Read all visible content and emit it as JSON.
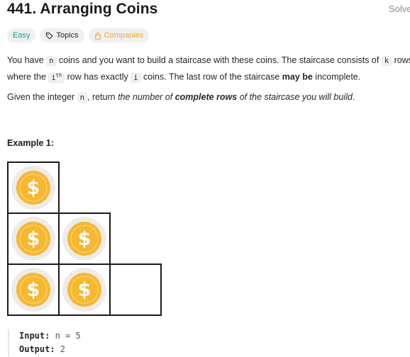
{
  "problem": {
    "title": "441. Arranging Coins",
    "status": "Solved"
  },
  "tags": {
    "difficulty": "Easy",
    "topics": "Topics",
    "companies": "Companies"
  },
  "description": {
    "p1_a": "You have ",
    "p1_code_n": "n",
    "p1_b": " coins and you want to build a staircase with these coins. The staircase consists of ",
    "p1_code_k": "k",
    "p1_c": " rows",
    "p1_d": "where the ",
    "p1_code_i": "i",
    "p1_code_sup": "th",
    "p1_e": " row has exactly ",
    "p1_code_i2": "i",
    "p1_f": " coins. The last row of the staircase ",
    "p1_bold": "may be",
    "p1_g": " incomplete.",
    "p2_a": "Given the integer ",
    "p2_code_n": "n",
    "p2_b": ", return ",
    "p2_i1": "the number of ",
    "p2_bold": "complete rows",
    "p2_i2": " of the staircase you will build",
    "p2_c": "."
  },
  "example": {
    "label": "Example 1:",
    "input_label": "Input:",
    "input_value": " n = 5",
    "output_label": "Output:",
    "output_value": " 2",
    "coin_symbol": "$"
  },
  "colors": {
    "easy": "#00a8a8",
    "companies": "#f5a623",
    "coin_fill": "#f7b731",
    "coin_halo": "#ececec"
  }
}
